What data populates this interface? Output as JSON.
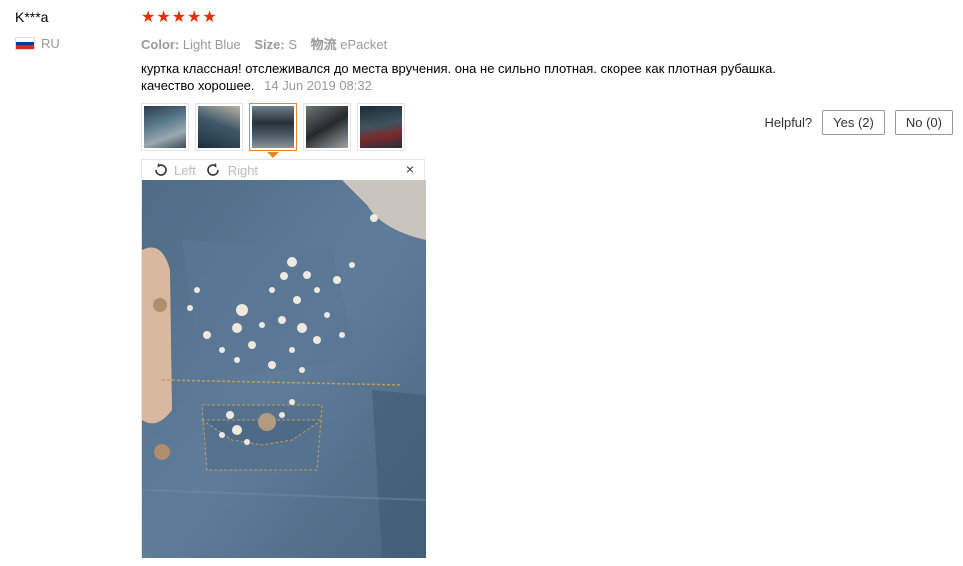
{
  "reviewer": {
    "name": "K***a",
    "country": "RU",
    "flag_icon": "russia-flag-icon",
    "flag_colors": [
      "#ffffff",
      "#0039a6",
      "#d52b1e"
    ]
  },
  "rating": {
    "stars": 5,
    "star_color": "#e62e04"
  },
  "attributes": [
    {
      "label": "Color:",
      "value": "Light Blue"
    },
    {
      "label": "Size:",
      "value": "S"
    },
    {
      "label": "物流",
      "value": "ePacket"
    }
  ],
  "review": {
    "line1": "куртка классная! отслеживался до места вручения. она не сильно плотная. скорее как плотная рубашка.",
    "line2": "качество хорошее.",
    "date": "14 Jun 2019 08:32"
  },
  "thumbnails": [
    {
      "name": "review-photo-1",
      "active": false
    },
    {
      "name": "review-photo-2",
      "active": false
    },
    {
      "name": "review-photo-3",
      "active": true
    },
    {
      "name": "review-photo-4",
      "active": false
    },
    {
      "name": "review-photo-5",
      "active": false
    }
  ],
  "helpful": {
    "label": "Helpful?",
    "yes": "Yes (2)",
    "no": "No (0)"
  },
  "viewer": {
    "rotate_left": "Left",
    "rotate_right": "Right",
    "close": "×",
    "accent_color": "#e8862c"
  }
}
